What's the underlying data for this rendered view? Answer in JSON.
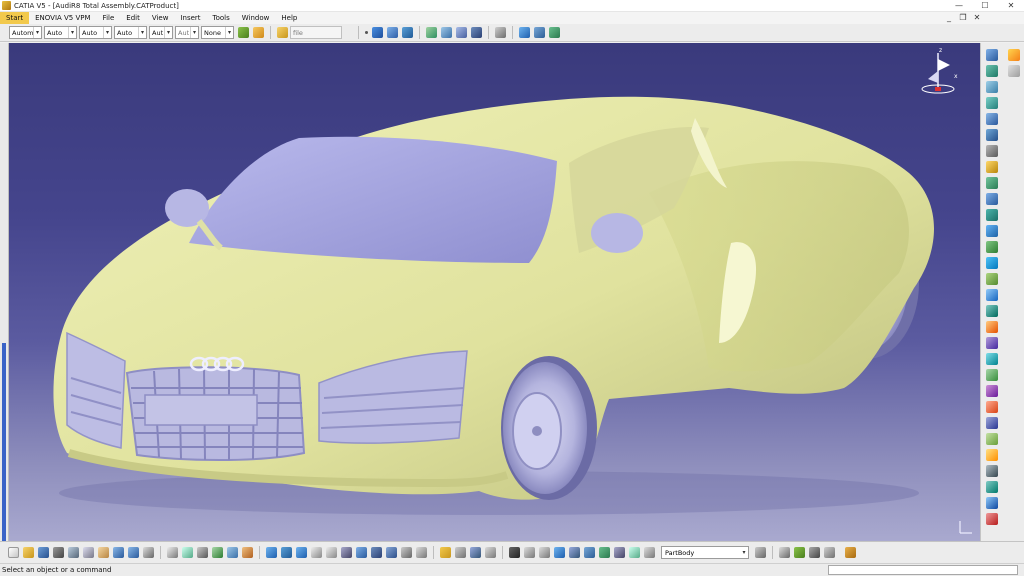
{
  "window": {
    "title": "CATIA V5 - [AudiR8 Total Assembly.CATProduct]",
    "controls": {
      "minimize": "—",
      "maximize": "☐",
      "close": "✕"
    }
  },
  "menu": {
    "items": [
      "Start",
      "ENOVIA V5 VPM",
      "File",
      "Edit",
      "View",
      "Insert",
      "Tools",
      "Window",
      "Help"
    ],
    "doc_controls": {
      "minimize": "_",
      "restore": "❐",
      "close": "✕"
    }
  },
  "toolbar_top": {
    "combos": [
      {
        "value": "Autom",
        "muted": false
      },
      {
        "value": "Auto",
        "muted": false
      },
      {
        "value": "Auto",
        "muted": false
      },
      {
        "value": "Auto",
        "muted": false
      },
      {
        "value": "Aut",
        "muted": false
      },
      {
        "value": "Aut",
        "muted": true
      },
      {
        "value": "None",
        "muted": false
      }
    ],
    "file_combo": {
      "value": "file",
      "muted": true
    }
  },
  "toolbar_bottom": {
    "part_combo": "PartBody"
  },
  "status": {
    "message": "Select an object or a command",
    "command_placeholder": ""
  },
  "icons": {
    "compass": "compass-icon",
    "axis": "axis-system-icon",
    "product": "product-icon"
  },
  "colors": {
    "viewport_top": "#3a3a7c",
    "viewport_bottom": "#a9a9cf",
    "car_body": "#e4e6a4",
    "glass": "#a9a9e0",
    "tire": "#b0b0dc",
    "highlight_menu": "#f2c94c"
  }
}
